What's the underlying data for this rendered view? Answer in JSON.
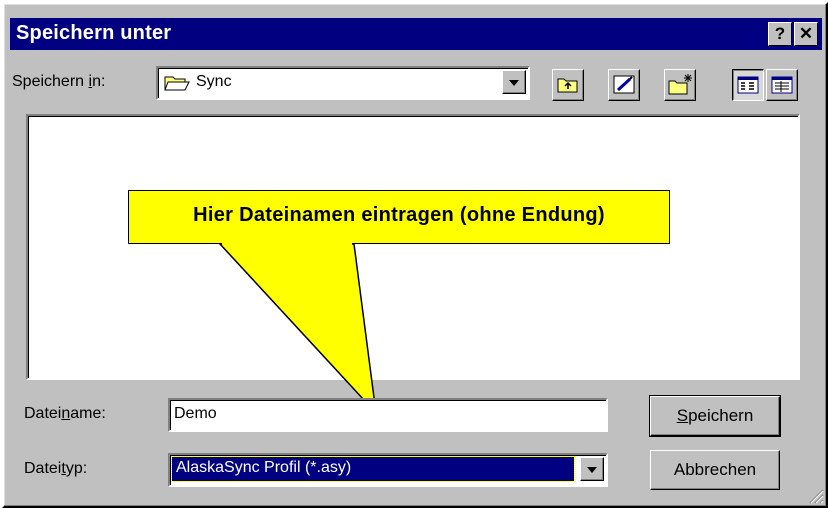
{
  "window": {
    "title": "Speichern unter",
    "help_label": "?",
    "close_label": "✕"
  },
  "savein": {
    "label_pre": "Speichern ",
    "label_u": "i",
    "label_post": "n:",
    "folder": "Sync",
    "folder_icon": "folder-open-icon"
  },
  "toolbar": {
    "items": [
      {
        "icon": "up-one-level-icon"
      },
      {
        "icon": "desktop-icon"
      },
      {
        "icon": "new-folder-icon"
      },
      {
        "icon": "list-view-icon",
        "pressed": true
      },
      {
        "icon": "details-view-icon"
      }
    ]
  },
  "callout": {
    "text": "Hier Dateinamen eintragen (ohne Endung)",
    "color": "#ffff00"
  },
  "filename": {
    "label_pre": "Datei",
    "label_u": "n",
    "label_post": "ame:",
    "value": "Demo"
  },
  "filetype": {
    "label_pre": "Datei",
    "label_u": "t",
    "label_post": "yp:",
    "value": "AlaskaSync Profil (*.asy)"
  },
  "buttons": {
    "save_u": "S",
    "save_rest": "peichern",
    "cancel": "Abbrechen"
  },
  "colors": {
    "titlebar": "#000080",
    "face": "#c0c0c0",
    "selection": "#000080"
  }
}
